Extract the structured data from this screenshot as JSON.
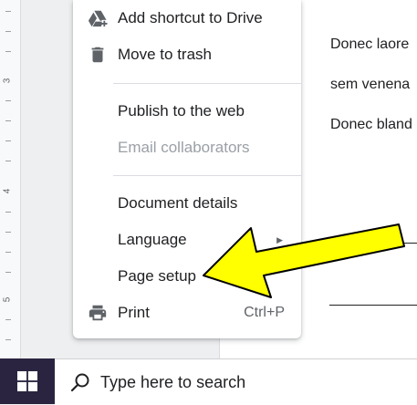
{
  "ruler": {
    "numbers": [
      "3",
      "4",
      "5"
    ]
  },
  "document": {
    "lines": [
      "Donec laore",
      "sem venena",
      "Donec bland"
    ]
  },
  "menu": {
    "items": [
      {
        "label": "Add shortcut to Drive",
        "icon": "drive-shortcut-icon"
      },
      {
        "label": "Move to trash",
        "icon": "trash-icon"
      },
      {
        "label": "Publish to the web"
      },
      {
        "label": "Email collaborators",
        "disabled": true
      },
      {
        "label": "Document details"
      },
      {
        "label": "Language",
        "submenu": true
      },
      {
        "label": "Page setup"
      },
      {
        "label": "Print",
        "icon": "print-icon",
        "shortcut": "Ctrl+P"
      }
    ]
  },
  "taskbar": {
    "start_icon": "windows-logo-icon",
    "search_icon": "search-icon",
    "search_placeholder": "Type here to search",
    "color": "#2b2440"
  },
  "annotation": {
    "arrow_color": "#ffff00",
    "points_to": "Page setup"
  }
}
